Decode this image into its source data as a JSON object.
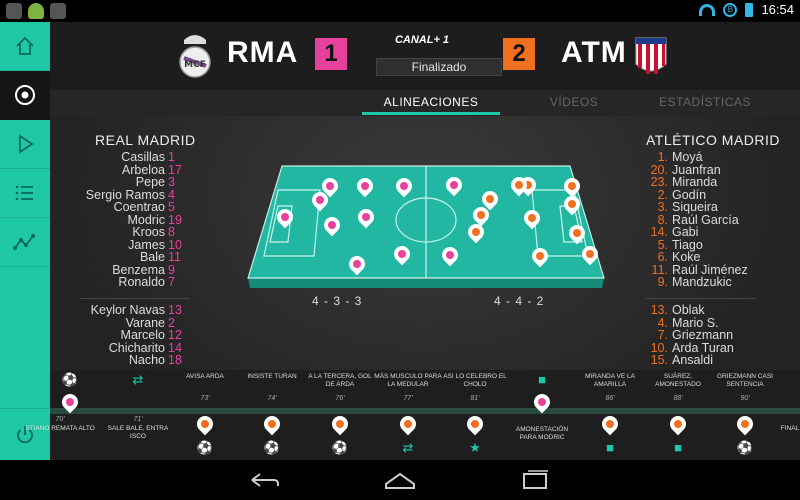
{
  "status_bar": {
    "time": "16:54"
  },
  "sidebar": {
    "items": [
      {
        "icon": "home-icon",
        "active": false
      },
      {
        "icon": "soccer-ball-icon",
        "active": true
      },
      {
        "icon": "play-icon",
        "active": false
      },
      {
        "icon": "list-icon",
        "active": false
      },
      {
        "icon": "stats-line-icon",
        "active": false
      }
    ],
    "power_icon": "power-icon"
  },
  "match": {
    "home_code": "RMA",
    "away_code": "ATM",
    "home_score": "1",
    "away_score": "2",
    "broadcaster": "CANAL+ 1",
    "status": "Finalizado",
    "home_color": "#e8419b",
    "away_color": "#f07022"
  },
  "tabs": [
    {
      "label": "ALINEACIONES",
      "active": true
    },
    {
      "label": "VÍDEOS",
      "active": false
    },
    {
      "label": "ESTADÍSTICAS",
      "active": false
    }
  ],
  "home_team": {
    "name": "REAL MADRID",
    "starters": [
      {
        "name": "Casillas",
        "number": "1"
      },
      {
        "name": "Arbeloa",
        "number": "17"
      },
      {
        "name": "Pepe",
        "number": "3"
      },
      {
        "name": "Sergio Ramos",
        "number": "4"
      },
      {
        "name": "Coentrao",
        "number": "5"
      },
      {
        "name": "Modric",
        "number": "19"
      },
      {
        "name": "Kroos",
        "number": "8"
      },
      {
        "name": "James",
        "number": "10"
      },
      {
        "name": "Bale",
        "number": "11"
      },
      {
        "name": "Benzema",
        "number": "9"
      },
      {
        "name": "Ronaldo",
        "number": "7"
      }
    ],
    "subs": [
      {
        "name": "Keylor Navas",
        "number": "13"
      },
      {
        "name": "Varane",
        "number": "2"
      },
      {
        "name": "Marcelo",
        "number": "12"
      },
      {
        "name": "Chicharito",
        "number": "14"
      },
      {
        "name": "Nacho",
        "number": "18"
      }
    ],
    "formation": "4 - 3 - 3"
  },
  "away_team": {
    "name": "ATLÉTICO MADRID",
    "starters": [
      {
        "name": "Moyá",
        "number": "1."
      },
      {
        "name": "Juanfran",
        "number": "20."
      },
      {
        "name": "Miranda",
        "number": "23."
      },
      {
        "name": "Godín",
        "number": "2."
      },
      {
        "name": "Siqueira",
        "number": "3."
      },
      {
        "name": "Raúl García",
        "number": "8."
      },
      {
        "name": "Gabi",
        "number": "14."
      },
      {
        "name": "Tiago",
        "number": "5."
      },
      {
        "name": "Koke",
        "number": "6."
      },
      {
        "name": "Raúl Jiménez",
        "number": "11."
      },
      {
        "name": "Mandzukic",
        "number": "9."
      }
    ],
    "subs": [
      {
        "name": "Oblak",
        "number": "13."
      },
      {
        "name": "Mario S.",
        "number": "4."
      },
      {
        "name": "Griezmann",
        "number": "7."
      },
      {
        "name": "Arda Turan",
        "number": "10."
      },
      {
        "name": "Ansaldi",
        "number": "15."
      }
    ],
    "formation": "4 - 4 - 2"
  },
  "timeline": {
    "top_events": [
      {
        "minute": "",
        "label": "",
        "icon": "whistle-ball-icon",
        "side": "home"
      },
      {
        "minute": "",
        "label": "",
        "icon": "substitution-icon",
        "side": "home"
      },
      {
        "minute": "73'",
        "label": "AVISA ARDA",
        "icon": "",
        "side": ""
      },
      {
        "minute": "74'",
        "label": "INSISTE TURAN",
        "icon": "",
        "side": ""
      },
      {
        "minute": "76'",
        "label": "A LA TERCERA, GOL DE ARDA",
        "icon": "",
        "side": ""
      },
      {
        "minute": "77'",
        "label": "MÁS MUSCULO PARA LA MEDULAR",
        "icon": "",
        "side": ""
      },
      {
        "minute": "81'",
        "label": "ASI LO CELEBRO EL CHOLO",
        "icon": "",
        "side": ""
      },
      {
        "minute": "84'",
        "label": "",
        "icon": "cards-icon",
        "side": "home"
      },
      {
        "minute": "86'",
        "label": "MIRANDA VE LA AMARILLA",
        "icon": "",
        "side": ""
      },
      {
        "minute": "88'",
        "label": "SUÁREZ, AMONESTADO",
        "icon": "",
        "side": ""
      },
      {
        "minute": "90'",
        "label": "GRIEZMANN CASI SENTENCIA",
        "icon": "",
        "side": ""
      }
    ],
    "bottom_events": [
      {
        "minute": "70'",
        "label": "STIANO REMATA ALTO",
        "icon": ""
      },
      {
        "minute": "71'",
        "label": "SALE BALE, ENTRA ISCO",
        "icon": ""
      },
      {
        "minute": "",
        "label": "",
        "icon": "whistle-ball-icon"
      },
      {
        "minute": "",
        "label": "",
        "icon": "whistle-ball-icon"
      },
      {
        "minute": "",
        "label": "",
        "icon": "ball-icon"
      },
      {
        "minute": "",
        "label": "",
        "icon": "substitution-icon"
      },
      {
        "minute": "",
        "label": "",
        "icon": "goal-star-icon"
      },
      {
        "minute": "",
        "label": "Amonestación para Modric",
        "icon": ""
      },
      {
        "minute": "",
        "label": "",
        "icon": "cards-icon"
      },
      {
        "minute": "",
        "label": "",
        "icon": "cards-icon"
      },
      {
        "minute": "",
        "label": "",
        "icon": "whistle-ball-icon"
      },
      {
        "minute": "",
        "label": "FINAL",
        "icon": ""
      }
    ]
  },
  "navbar": {
    "back": "back-icon",
    "home": "home-icon",
    "recents": "recents-icon"
  }
}
